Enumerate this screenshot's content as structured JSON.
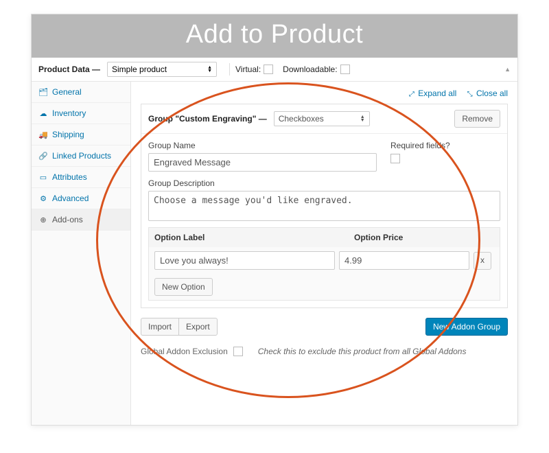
{
  "banner": {
    "title": "Add to Product"
  },
  "header": {
    "product_data_label": "Product Data —",
    "product_type": "Simple product",
    "virtual_label": "Virtual:",
    "downloadable_label": "Downloadable:"
  },
  "sidebar": {
    "items": [
      {
        "icon": "🗂",
        "label": "General"
      },
      {
        "icon": "☁",
        "label": "Inventory"
      },
      {
        "icon": "🚚",
        "label": "Shipping"
      },
      {
        "icon": "🔗",
        "label": "Linked Products"
      },
      {
        "icon": "▭",
        "label": "Attributes"
      },
      {
        "icon": "⚙",
        "label": "Advanced"
      },
      {
        "icon": "⊕",
        "label": "Add-ons"
      }
    ]
  },
  "main": {
    "expand_all": "Expand all",
    "close_all": "Close all",
    "group_head_label": "Group \"Custom Engraving\" —",
    "group_type": "Checkboxes",
    "remove_label": "Remove",
    "group_name_label": "Group Name",
    "group_name_value": "Engraved Message",
    "required_label": "Required fields?",
    "group_desc_label": "Group Description",
    "group_desc_value": "Choose a message you'd like engraved.",
    "option_label_header": "Option Label",
    "option_price_header": "Option Price",
    "option_label_value": "Love you always!",
    "option_price_value": "4.99",
    "x_label": "x",
    "new_option_label": "New Option",
    "import_label": "Import",
    "export_label": "Export",
    "new_addon_group_label": "New Addon Group",
    "global_exclusion_label": "Global Addon Exclusion",
    "global_exclusion_hint": "Check this to exclude this product from all Global Addons"
  }
}
